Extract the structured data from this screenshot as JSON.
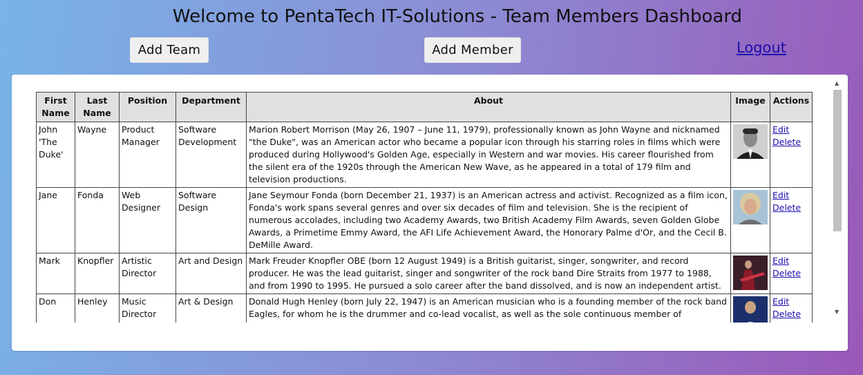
{
  "header": {
    "title": "Welcome to PentaTech IT-Solutions - Team Members Dashboard",
    "add_team_label": "Add Team",
    "add_member_label": "Add Member",
    "logout_label": "Logout"
  },
  "table": {
    "columns": [
      "First Name",
      "Last Name",
      "Position",
      "Department",
      "About",
      "Image",
      "Actions"
    ],
    "rows": [
      {
        "first": "John 'The Duke'",
        "last": "Wayne",
        "position": "Product Manager",
        "department": "Software Development",
        "about": "Marion Robert Morrison (May 26, 1907 – June 11, 1979), professionally known as John Wayne and nicknamed \"the Duke\", was an American actor who became a popular icon through his starring roles in films which were produced during Hollywood's Golden Age, especially in Western and war movies. His career flourished from the silent era of the 1920s through the American New Wave, as he appeared in a total of 179 film and television productions.",
        "image": "portrait-john-wayne",
        "edit": "Edit",
        "delete": "Delete"
      },
      {
        "first": "Jane",
        "last": "Fonda",
        "position": "Web Designer",
        "department": "Software Design",
        "about": "Jane Seymour Fonda (born December 21, 1937) is an American actress and activist. Recognized as a film icon, Fonda's work spans several genres and over six decades of film and television. She is the recipient of numerous accolades, including two Academy Awards, two British Academy Film Awards, seven Golden Globe Awards, a Primetime Emmy Award, the AFI Life Achievement Award, the Honorary Palme d'Or, and the Cecil B. DeMille Award.",
        "image": "portrait-jane-fonda",
        "edit": "Edit",
        "delete": "Delete"
      },
      {
        "first": "Mark",
        "last": "Knopfler",
        "position": "Artistic Director",
        "department": "Art and Design",
        "about": "Mark Freuder Knopfler OBE (born 12 August 1949) is a British guitarist, singer, songwriter, and record producer. He was the lead guitarist, singer and songwriter of the rock band Dire Straits from 1977 to 1988, and from 1990 to 1995. He pursued a solo career after the band dissolved, and is now an independent artist.",
        "image": "portrait-mark-knopfler",
        "edit": "Edit",
        "delete": "Delete"
      },
      {
        "first": "Don",
        "last": "Henley",
        "position": "Music Director",
        "department": "Art & Design",
        "about": "Donald Hugh Henley (born July 22, 1947) is an American musician who is a founding member of the rock band Eagles, for whom he is the drummer and co-lead vocalist, as well as the sole continuous member of",
        "image": "portrait-don-henley",
        "edit": "Edit",
        "delete": "Delete"
      }
    ]
  }
}
